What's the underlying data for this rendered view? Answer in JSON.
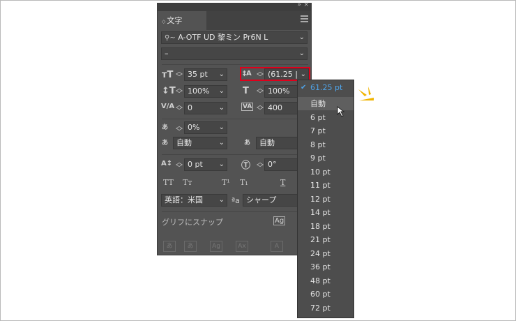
{
  "panel": {
    "tab_label": "文字",
    "font_family": "A-OTF UD 黎ミン Pr6N L",
    "font_style": "–",
    "font_size": "35 pt",
    "leading": "(61.25 |",
    "vertical_scale": "100%",
    "horizontal_scale": "100%",
    "kerning": "0",
    "tracking": "400",
    "tsume": "0%",
    "aki_left": "自動",
    "aki_right": "自動",
    "baseline_shift": "0 pt",
    "rotation": "0°",
    "tt_buttons": [
      "TT",
      "Tт",
      "T¹",
      "T₁",
      "T"
    ],
    "language": "英語：米国",
    "antialias_label": "ªa",
    "antialias": "シャープ",
    "snap_label": "グリフにスナップ"
  },
  "leading_dropdown": {
    "selected": "61.25 pt",
    "items": [
      "自動",
      "6 pt",
      "7 pt",
      "8 pt",
      "9 pt",
      "10 pt",
      "11 pt",
      "12 pt",
      "14 pt",
      "18 pt",
      "21 pt",
      "24 pt",
      "36 pt",
      "48 pt",
      "60 pt",
      "72 pt"
    ]
  },
  "colors": {
    "panel_bg": "#535353",
    "highlight": "#e0001b",
    "selected_text": "#4fa3e8",
    "accent_marks": "#f0b400"
  }
}
